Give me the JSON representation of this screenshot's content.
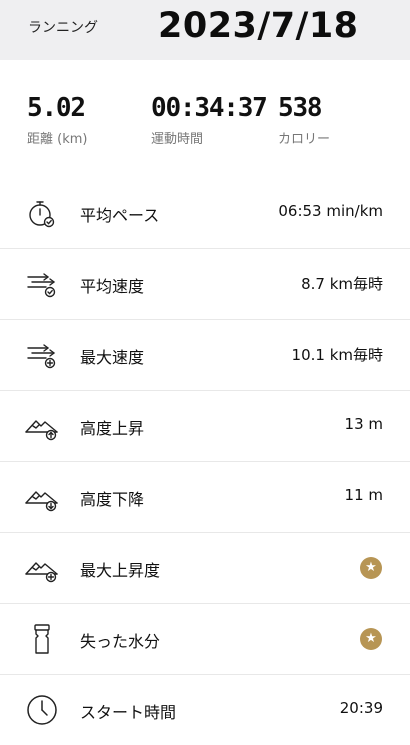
{
  "header": {
    "activity": "ランニング",
    "date": "2023/7/18"
  },
  "summary": [
    {
      "value": "5.02",
      "label": "距離 (km)"
    },
    {
      "value": "00:34:37",
      "label": "運動時間"
    },
    {
      "value": "538",
      "label": "カロリー"
    }
  ],
  "rows": [
    {
      "icon": "stopwatch-icon",
      "label": "平均ペース",
      "value": "06:53 min/km"
    },
    {
      "icon": "speed-lines-check-icon",
      "label": "平均速度",
      "value": "8.7 km毎時"
    },
    {
      "icon": "speed-lines-plus-icon",
      "label": "最大速度",
      "value": "10.1 km毎時"
    },
    {
      "icon": "mountain-up-icon",
      "label": "高度上昇",
      "value": "13 m"
    },
    {
      "icon": "mountain-down-icon",
      "label": "高度下降",
      "value": "11 m"
    },
    {
      "icon": "mountain-plus-icon",
      "label": "最大上昇度",
      "value": "★"
    },
    {
      "icon": "water-bottle-icon",
      "label": "失った水分",
      "value": "★"
    },
    {
      "icon": "clock-icon",
      "label": "スタート時間",
      "value": "20:39"
    }
  ],
  "colors": {
    "accent_gold": "#b79554",
    "header_bg": "#efeff1",
    "divider": "#e8e8e8"
  }
}
